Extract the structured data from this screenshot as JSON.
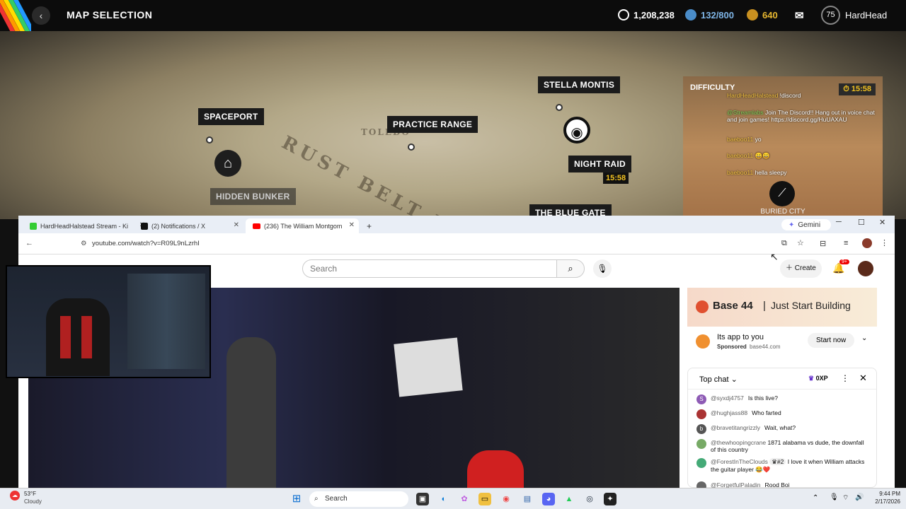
{
  "game": {
    "title": "MAP SELECTION",
    "stats": [
      {
        "icon": "shield-coin-icon",
        "value": "1,208,238",
        "color": "#ffffff"
      },
      {
        "icon": "blue-token-icon",
        "value": "132/800",
        "color": "#7fb6e8"
      },
      {
        "icon": "gold-coin-icon",
        "value": "640",
        "color": "#e8b830"
      }
    ],
    "level": "75",
    "username": "HardHead",
    "maps": {
      "spaceport": "SPACEPORT",
      "hidden_bunker": "HIDDEN BUNKER",
      "practice_range": "PRACTICE RANGE",
      "stella_montis": "STELLA MONTIS",
      "night_raid": "NIGHT RAID",
      "night_raid_time": "15:58",
      "blue_gate": "THE BLUE GATE",
      "buried_city": "BURIED CITY"
    },
    "map_text": [
      "RUST BELT RIDGE",
      "TOLEDO"
    ],
    "overlay": {
      "difficulty": "DIFFICULTY",
      "timer": "15:58",
      "chat": [
        {
          "user": "HardHeadHalstead",
          "text": "!discord"
        },
        {
          "user": "@Streamlabs",
          "text": "Join The Discord!! Hang out in voice chat and join games! https://discord.gg/HuUAXAU"
        },
        {
          "user": "baeboo11",
          "text": "yo"
        },
        {
          "user": "baeboo11",
          "text": "😀😀"
        },
        {
          "user": "baeboo11",
          "text": "hella sleepy"
        }
      ]
    }
  },
  "browser": {
    "tabs": [
      {
        "label": "HardHeadHalstead Stream - Ki"
      },
      {
        "label": "(2) Notifications / X"
      },
      {
        "label": "(236) The William Montgom"
      }
    ],
    "gemini": "Gemini",
    "url": "youtube.com/watch?v=R09L9nLzrhI",
    "search_placeholder": "Search",
    "create": "Create",
    "notif_count": "9+",
    "banner": {
      "brand": "Base 44",
      "tagline": "Just Start Building"
    },
    "ad": {
      "title": "Its app to you",
      "sponsored": "Sponsored",
      "domain": "base44.com",
      "cta": "Start now"
    },
    "chat": {
      "header": "Top chat",
      "xp": "0XP",
      "messages": [
        {
          "initial": "S",
          "user": "@syxdj4757",
          "text": "Is this live?",
          "color": "#8e5bb5"
        },
        {
          "initial": "",
          "user": "@hughjass88",
          "text": "Who farted",
          "color": "#a33"
        },
        {
          "initial": "b",
          "user": "@bravetitangrizzly",
          "text": "Wait, what?",
          "color": "#555"
        },
        {
          "initial": "",
          "user": "@thewhoopingcrane",
          "text": "1871 alabama vs dude, the downfall of this country",
          "color": "#7a6"
        },
        {
          "initial": "",
          "user": "@ForestInTheClouds",
          "badge": "#2",
          "text": "I love it when William attacks the guitar player 😂❤️",
          "color": "#4a7"
        },
        {
          "initial": "",
          "user": "@ForgetfulPaladin",
          "text": "Rood Boi",
          "color": "#666"
        }
      ]
    }
  },
  "taskbar": {
    "weather_temp": "53°F",
    "weather_desc": "Cloudy",
    "search": "Search",
    "time": "9:44 PM",
    "date": "2/17/2026"
  }
}
